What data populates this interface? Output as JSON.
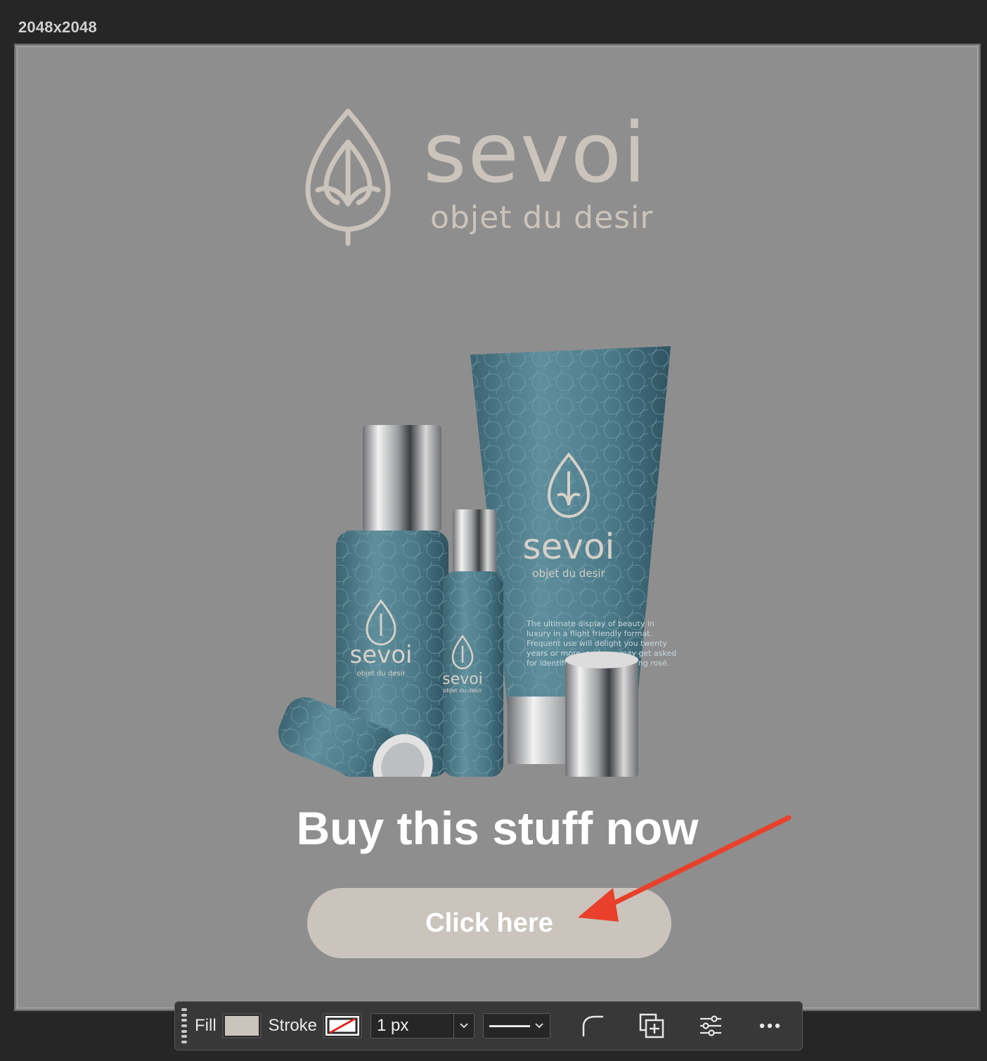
{
  "document": {
    "size_label": "2048x2048"
  },
  "artboard": {
    "background": "#8e8e8e",
    "brand": {
      "name": "sevoi",
      "tagline": "objet du desir",
      "color": "#cbc4bc"
    },
    "headline": "Buy this stuff now",
    "cta_label": "Click here",
    "cta_color": "#cbc4bd",
    "product_labels": {
      "tube_brand": "sevoi",
      "tube_tagline": "objet du desir",
      "tube_body": [
        "The ultimate display of beauty in",
        "luxury in a flight friendly format.",
        "Frequent use will delight you twenty",
        "years or more, and you may get asked",
        "for identification while ordering rosé."
      ],
      "bottle_brand": "sevoi",
      "bottle_tagline": "objet du desir",
      "spray_brand": "sevoi",
      "spray_tagline": "objet du desir"
    }
  },
  "annotation": {
    "arrow_color": "#e8402a"
  },
  "toolbar": {
    "fill_label": "Fill",
    "fill_color": "#cbc4bd",
    "stroke_label": "Stroke",
    "stroke_width": "1 px",
    "icons": [
      "corner-radius-icon",
      "add-shape-icon",
      "adjust-sliders-icon",
      "more-options-icon"
    ]
  }
}
